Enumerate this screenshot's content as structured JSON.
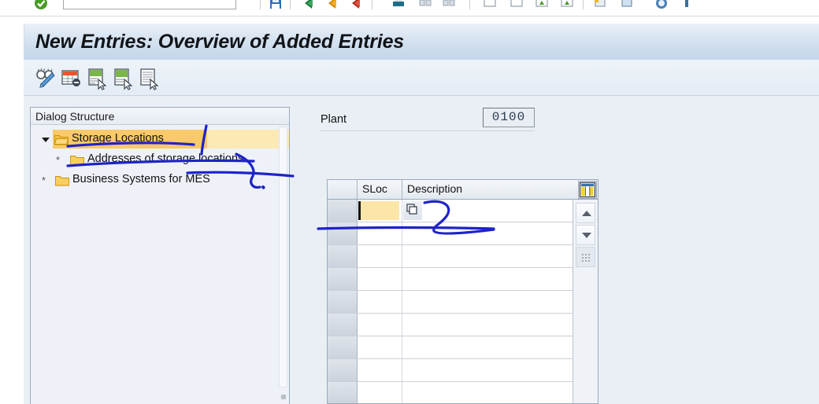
{
  "window": {
    "title": "New Entries: Overview of Added Entries"
  },
  "system_toolbar": {
    "command_field_value": "",
    "command_field_placeholder": "",
    "icons": [
      "green-check-enter-icon",
      "save-icon",
      "back-icon",
      "exit-icon",
      "cancel-icon",
      "print-icon",
      "find-icon",
      "find-next-icon",
      "first-page-icon",
      "previous-page-icon",
      "next-page-icon",
      "last-page-icon",
      "create-session-icon",
      "create-shortcut-icon",
      "help-icon",
      "customize-local-layout-icon"
    ]
  },
  "app_toolbar": {
    "buttons": [
      {
        "name": "display-change-button",
        "icon": "glasses-pencil-icon",
        "label": "Display/Change"
      },
      {
        "name": "variable-list-button",
        "icon": "table-red-header-icon",
        "label": "Variable List"
      },
      {
        "name": "new-entries-button",
        "icon": "new-entries-green-icon",
        "label": "New Entries"
      },
      {
        "name": "copy-as-button",
        "icon": "copy-as-green-icon",
        "label": "Copy As..."
      },
      {
        "name": "delete-button",
        "icon": "select-all-lines-icon",
        "label": "Delete"
      }
    ]
  },
  "dialog_structure": {
    "header": "Dialog Structure",
    "items": [
      {
        "label": "Storage Locations",
        "indent": 0,
        "marker": "triangle",
        "folder": "open-folder-icon",
        "selected": true
      },
      {
        "label": "Addresses of storage locations",
        "indent": 1,
        "marker": "asterisk",
        "folder": "closed-folder-icon",
        "selected": false
      },
      {
        "label": "Business Systems for MES",
        "indent": 0,
        "marker": "asterisk",
        "folder": "closed-folder-icon",
        "selected": false
      }
    ]
  },
  "detail": {
    "plant": {
      "label": "Plant",
      "value": "0100"
    },
    "table": {
      "columns": [
        "",
        "SLoc",
        "Description"
      ],
      "settings_icon": "table-settings-icon",
      "rows": [
        {
          "sloc": "",
          "description": "",
          "active": true
        },
        {
          "sloc": "",
          "description": "",
          "active": false
        },
        {
          "sloc": "",
          "description": "",
          "active": false
        },
        {
          "sloc": "",
          "description": "",
          "active": false
        },
        {
          "sloc": "",
          "description": "",
          "active": false
        },
        {
          "sloc": "",
          "description": "",
          "active": false
        },
        {
          "sloc": "",
          "description": "",
          "active": false
        },
        {
          "sloc": "",
          "description": "",
          "active": false
        },
        {
          "sloc": "",
          "description": "",
          "active": false
        }
      ],
      "nav": {
        "scroll_up": "scroll-up-icon",
        "scroll_down": "scroll-down-icon",
        "resize_grip": "resize-grip-icon"
      }
    }
  },
  "colors": {
    "title_bar_start": "#eaf0f7",
    "title_bar_end": "#c3d6ea",
    "selection_orange": "#f9c96a",
    "selection_yellow": "#fce9b4",
    "folder_yellow": "#f5c243",
    "input_focus_yellow": "#fbe6a8",
    "ink_blue": "#1f23c8",
    "content_bg": "#eaeff5"
  },
  "annotations": {
    "ink_color": "#1f23c8",
    "strokes": [
      "underline-storage-locations",
      "vertical-tick-right-of-storage-locations",
      "underline-addresses-of-storage-locations",
      "curved-bracket-near-business-systems",
      "long-diagonal-arrow-to-table",
      "curl-over-description-cell",
      "underline-under-first-table-row"
    ]
  }
}
